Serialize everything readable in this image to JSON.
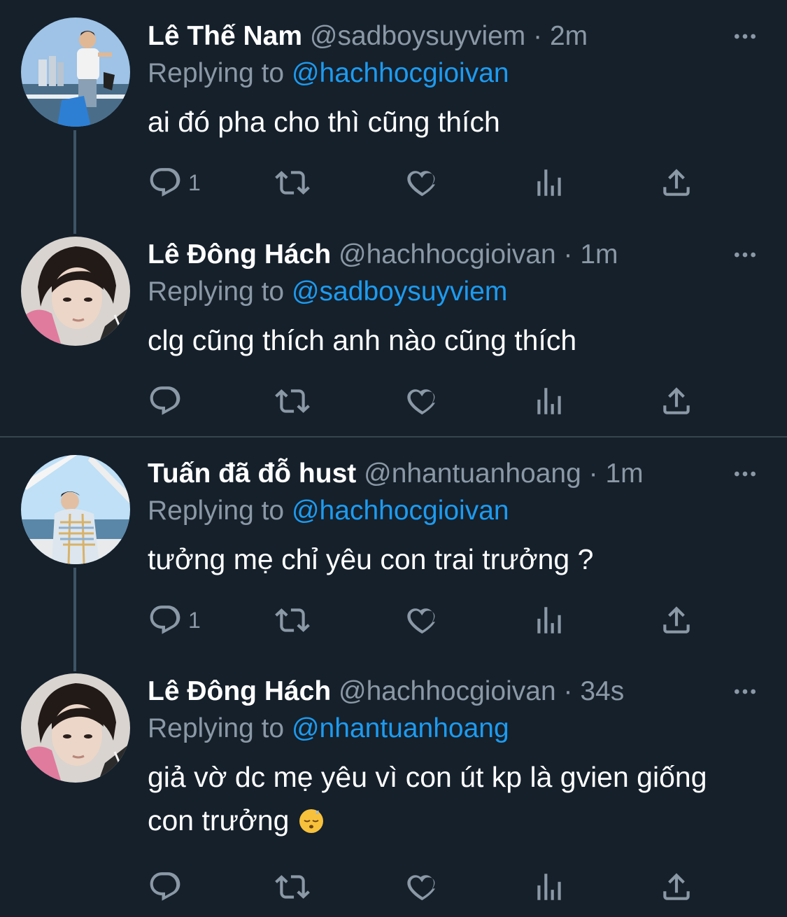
{
  "tweets": [
    {
      "name": "Lê Thế Nam",
      "handle": "@sadboysuyviem",
      "time": "· 2m",
      "replying_prefix": "Replying to",
      "replying_handle": "@hachhocgioivan",
      "text": "ai đó pha cho thì cũng thích",
      "reply_count": "1"
    },
    {
      "name": "Lê Đông Hách",
      "handle": "@hachhocgioivan",
      "time": "· 1m",
      "replying_prefix": "Replying to",
      "replying_handle": "@sadboysuyviem",
      "text": "clg cũng thích anh nào cũng thích",
      "reply_count": ""
    },
    {
      "name": "Tuấn đã đỗ hust",
      "handle": "@nhantuanhoang",
      "time": "· 1m",
      "replying_prefix": "Replying to",
      "replying_handle": "@hachhocgioivan",
      "text": "tưởng mẹ chỉ yêu con trai trưởng ?",
      "reply_count": "1"
    },
    {
      "name": "Lê Đông Hách",
      "handle": "@hachhocgioivan",
      "time": "· 34s",
      "replying_prefix": "Replying to",
      "replying_handle": "@nhantuanhoang",
      "text_line1": "giả vờ dc mẹ yêu vì con út kp là gvien giống",
      "text_line2": "con trưởng",
      "reply_count": ""
    }
  ],
  "colors": {
    "background": "#15202b",
    "link": "#1d9bf0",
    "muted": "#8b98a5",
    "divider": "#38444d"
  },
  "icons": [
    "reply-icon",
    "retweet-icon",
    "like-icon",
    "views-icon",
    "share-icon",
    "more-icon",
    "sleeping-face-emoji"
  ]
}
